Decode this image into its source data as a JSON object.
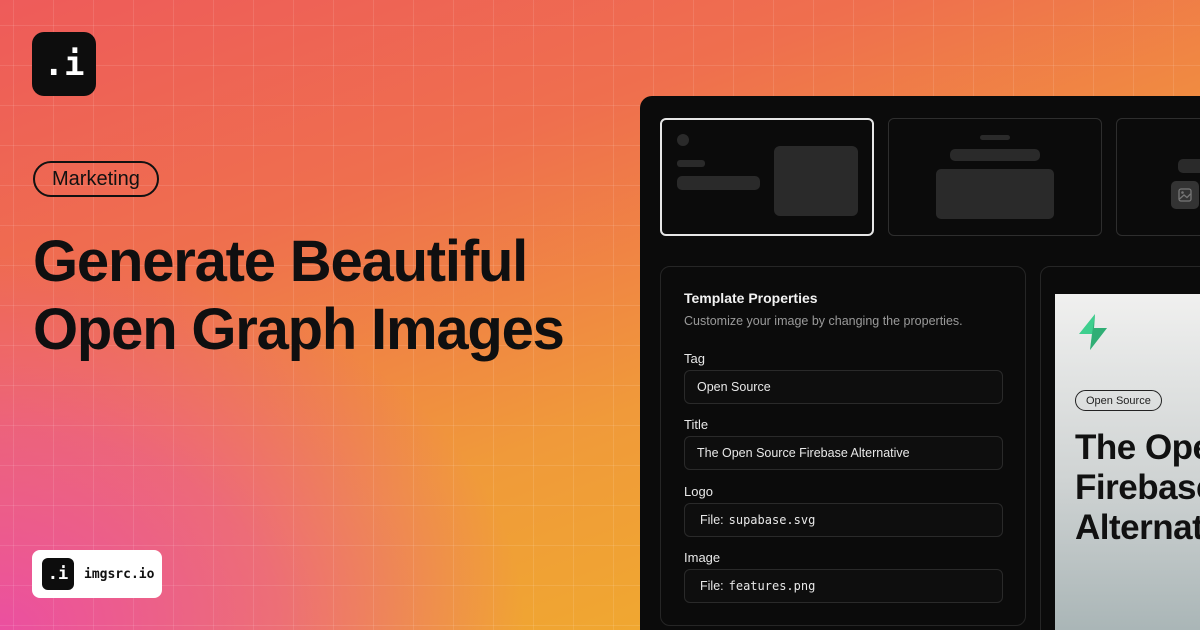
{
  "brand": {
    "logo_text": ".i",
    "name": "imgsrc.io"
  },
  "hero": {
    "tag": "Marketing",
    "headline_line1": "Generate Beautiful",
    "headline_line2": "Open Graph Images"
  },
  "templates": [
    {
      "name": "template-1",
      "selected": true
    },
    {
      "name": "template-2",
      "selected": false
    },
    {
      "name": "template-3",
      "selected": false
    }
  ],
  "properties": {
    "title": "Template Properties",
    "subtitle": "Customize your image by changing the properties.",
    "fields": [
      {
        "label": "Tag",
        "value": "Open Source"
      },
      {
        "label": "Title",
        "value": "The Open Source Firebase Alternative"
      },
      {
        "label": "Logo",
        "prefix": "File:",
        "value": "supabase.svg"
      },
      {
        "label": "Image",
        "prefix": "File:",
        "value": "features.png"
      }
    ]
  },
  "preview": {
    "tag": "Open Source",
    "title_line1": "The Open Source",
    "title_line2": "Firebase Alternative",
    "logo_color": "#3ecf8e"
  },
  "colors": {
    "bg_pink": "#eb4fa0",
    "bg_coral": "#ee5b5a",
    "bg_orange": "#f09a3a",
    "bg_yellow": "#f0b328",
    "panel": "#0b0b0b"
  }
}
